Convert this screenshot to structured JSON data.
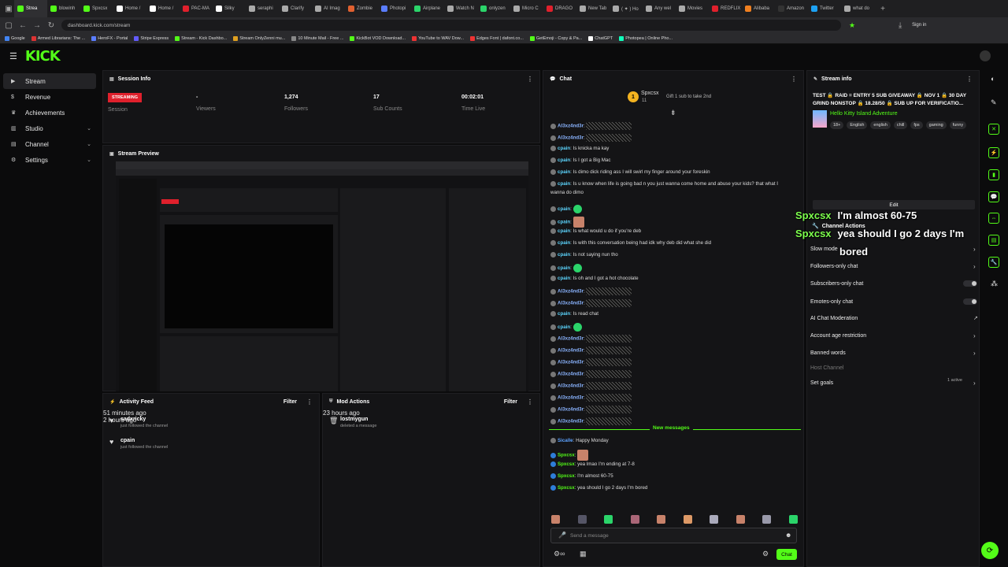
{
  "browser": {
    "tabs": [
      "Strea",
      "blowinh",
      "Spxcsx",
      "Home /",
      "Home /",
      "PAC-MA",
      "Silky",
      "seraphi",
      "Clarify",
      "AI Imag",
      "Zombie",
      "Photopi",
      "Airplane",
      "Watch N",
      "onlyzen",
      "Micro C",
      "DRAGO",
      "New Tab",
      "( ✦ ) Ho",
      "Any wel",
      "Movies",
      "REDFLIX",
      "Alibaba",
      "Amazon",
      "Twitter",
      "what do"
    ],
    "url": "dashboard.kick.com/stream",
    "sign_in": "Sign in",
    "bookmarks": [
      "Google",
      "Armed Librarians: The ...",
      "HeroFX - Portal",
      "Stripe Express",
      "Stream - Kick Dashbo...",
      "Stream OnlyZenni mu...",
      "10 Minute Mail - Free ...",
      "KickBot VOD Download...",
      "YouTube to WAV Dow...",
      "Edges Font | dafont.co...",
      "GetEmoji - Copy & Pa...",
      "ChatGPT",
      "Photopea | Online Pho..."
    ]
  },
  "brand": "KICK",
  "sidebar": {
    "items": [
      {
        "label": "Stream",
        "icon": "video-icon"
      },
      {
        "label": "Revenue",
        "icon": "money-icon"
      },
      {
        "label": "Achievements",
        "icon": "trophy-icon"
      },
      {
        "label": "Studio",
        "icon": "studio-icon"
      },
      {
        "label": "Channel",
        "icon": "channel-icon"
      },
      {
        "label": "Settings",
        "icon": "gear-icon"
      }
    ]
  },
  "session": {
    "title": "Session Info",
    "live_badge": "STREAMING",
    "session_label": "Session",
    "viewers_value": "-",
    "viewers_label": "Viewers",
    "followers_value": "1,274",
    "followers_label": "Followers",
    "subs_value": "17",
    "subs_label": "Sub Counts",
    "time_value": "00:02:01",
    "time_label": "Time Live"
  },
  "preview": {
    "title": "Stream Preview"
  },
  "activity": {
    "title": "Activity Feed",
    "filter": "Filter",
    "items": [
      {
        "name": "sadxricky",
        "sub": "just followed the channel",
        "time": "51 minutes ago"
      },
      {
        "name": "cpain",
        "sub": "just followed the channel",
        "time": "2 hours ago"
      }
    ]
  },
  "mod": {
    "title": "Mod Actions",
    "filter": "Filter",
    "items": [
      {
        "name": "lostmygun",
        "sub": "deleted a message",
        "time": "23 hours ago"
      }
    ]
  },
  "chat": {
    "title": "Chat",
    "pinned_user": "Spxcsx",
    "pinned_count": "11",
    "gift_text": "Gift 1 sub to take 2nd",
    "messages": [
      {
        "user": "Al3xz4nd3r",
        "text": "",
        "color": "#8ab4ff",
        "kind": "noise"
      },
      {
        "user": "Al3xz4nd3r",
        "text": "",
        "color": "#8ab4ff",
        "kind": "noise"
      },
      {
        "user": "cpain",
        "text": "Is knicka ma kay",
        "color": "#5dd6ff"
      },
      {
        "user": "cpain",
        "text": "Is I got a Big Mac",
        "color": "#5dd6ff"
      },
      {
        "user": "cpain",
        "text": "Is dimo dick riding ass I will swirl my finger around your foreskin",
        "color": "#5dd6ff"
      },
      {
        "user": "cpain",
        "text": "Is u know when life is going bad n you just wanna come home and abuse your kids? that what I",
        "color": "#5dd6ff"
      },
      {
        "user": "",
        "text": "wanna do dimo",
        "color": "#5dd6ff"
      },
      {
        "user": "cpain",
        "text": "",
        "color": "#5dd6ff",
        "kind": "emote-green"
      },
      {
        "user": "cpain",
        "text": "",
        "color": "#5dd6ff",
        "kind": "emote-face"
      },
      {
        "user": "cpain",
        "text": "Is what would u do if you're deb",
        "color": "#5dd6ff"
      },
      {
        "user": "cpain",
        "text": "Is with this conversation being had idk why deb did what she did",
        "color": "#5dd6ff"
      },
      {
        "user": "cpain",
        "text": "Is not saying nun tho",
        "color": "#5dd6ff"
      },
      {
        "user": "cpain",
        "text": "",
        "color": "#5dd6ff",
        "kind": "emote-green"
      },
      {
        "user": "cpain",
        "text": "Is oh and I got a hot chocolate",
        "color": "#5dd6ff"
      },
      {
        "user": "Al3xz4nd3r",
        "text": "",
        "color": "#8ab4ff",
        "kind": "noise"
      },
      {
        "user": "Al3xz4nd3r",
        "text": "",
        "color": "#8ab4ff",
        "kind": "noise"
      },
      {
        "user": "cpain",
        "text": "Is read chat",
        "color": "#5dd6ff"
      },
      {
        "user": "cpain",
        "text": "",
        "color": "#5dd6ff",
        "kind": "emote-green"
      },
      {
        "user": "Al3xz4nd3r",
        "text": "",
        "color": "#8ab4ff",
        "kind": "noise"
      },
      {
        "user": "Al3xz4nd3r",
        "text": "",
        "color": "#8ab4ff",
        "kind": "noise"
      },
      {
        "user": "Al3xz4nd3r",
        "text": "",
        "color": "#8ab4ff",
        "kind": "noise"
      },
      {
        "user": "Al3xz4nd3r",
        "text": "",
        "color": "#8ab4ff",
        "kind": "noise"
      },
      {
        "user": "Al3xz4nd3r",
        "text": "",
        "color": "#8ab4ff",
        "kind": "noise"
      },
      {
        "user": "Al3xz4nd3r",
        "text": "",
        "color": "#8ab4ff",
        "kind": "noise"
      },
      {
        "user": "Al3xz4nd3r",
        "text": "",
        "color": "#8ab4ff",
        "kind": "noise"
      },
      {
        "user": "Al3xz4nd3r",
        "text": "",
        "color": "#8ab4ff",
        "kind": "noise"
      }
    ],
    "new_messages": "New messages",
    "new": [
      {
        "user": "Sicalle",
        "text": "Happy Monday",
        "color": "#5da3ff",
        "kind": "text"
      },
      {
        "user": "Spxcsx",
        "text": "",
        "color": "#53fc18",
        "kind": "emote-face"
      },
      {
        "user": "Spxcsx",
        "text": "yea lmao I'm ending at 7-8",
        "color": "#53fc18",
        "kind": "text"
      },
      {
        "user": "Spxcsx",
        "text": "I'm almost 60-75",
        "color": "#53fc18",
        "kind": "text"
      },
      {
        "user": "Spxcsx",
        "text": "yea should I go 2 days I'm bored",
        "color": "#53fc18",
        "kind": "text"
      }
    ],
    "placeholder": "Send a message",
    "send": "Chat"
  },
  "stream_info": {
    "title": "Stream info",
    "stream_title": "TEST 🔒 RAID = ENTRY 5 SUB GIVEAWAY 🔒 NOV 1 🔒 30 DAY GRIND NONSTOP 🔒 18.28/50 🔒 SUB UP FOR VERIFICATIO...",
    "category": "Hello Kitty Island Adventure",
    "tags": [
      "18+",
      "English",
      "english",
      "chill",
      "fps",
      "gaming",
      "funny"
    ],
    "edit": "Edit"
  },
  "channel_actions": {
    "title": "Channel Actions",
    "items": [
      {
        "label": "Slow mode",
        "kind": "chevron"
      },
      {
        "label": "Followers-only chat",
        "kind": "chevron"
      },
      {
        "label": "Subscribers-only chat",
        "kind": "toggle"
      },
      {
        "label": "Emotes-only chat",
        "kind": "toggle"
      },
      {
        "label": "AI Chat Moderation",
        "kind": "external"
      },
      {
        "label": "Account age restriction",
        "kind": "chevron"
      },
      {
        "label": "Banned words",
        "kind": "chevron"
      },
      {
        "label": "Host Channel",
        "kind": "none"
      },
      {
        "label": "Set goals",
        "kind": "chevron"
      }
    ],
    "goals_active": "1 active"
  },
  "overlay": [
    {
      "user": "Spxcsx",
      "text": "I'm almost 60-75"
    },
    {
      "user": "Spxcsx",
      "text": "yea should I go 2 days I'm"
    },
    {
      "user": "",
      "text": "bored"
    }
  ],
  "colors": {
    "accent": "#53fc18",
    "live": "#e0202c",
    "panel": "#141416"
  }
}
